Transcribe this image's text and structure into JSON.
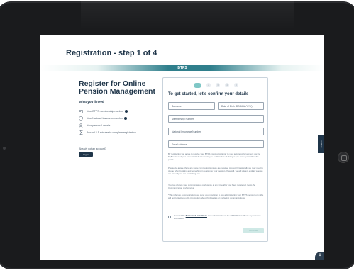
{
  "page": {
    "title": "Registration - step 1 of 4",
    "brand": "BTPS"
  },
  "intro": {
    "title_line1": "Register for Online",
    "title_line2": "Pension Management",
    "need_heading": "What you'll need",
    "items": [
      {
        "icon": "id-card-icon",
        "label": "Your BTPS membership number",
        "info": true
      },
      {
        "icon": "shield-icon",
        "label": "Your National Insurance number",
        "info": true
      },
      {
        "icon": "person-icon",
        "label": "Your personal details",
        "info": false
      },
      {
        "icon": "hourglass-icon",
        "label": "Around 2-5 minutes to complete registration",
        "info": false
      }
    ],
    "have_account": "Already got an account?",
    "login_label": "Log in"
  },
  "form": {
    "steps": [
      "1",
      "2",
      "3",
      "4",
      "5"
    ],
    "active_step": 0,
    "heading": "To get started, let's confirm your details",
    "fields": {
      "surname": "Surname",
      "dob": "Date of Birth (DD/MM/YYYY)",
      "membership": "Membership number",
      "ni": "National Insurance Number",
      "email": "Email Address"
    },
    "legal_1": "By registering you agree to receive your BTPS communications* to your secure portal account via the MyBox area of your account. We'll also email you confirmation of changes you make yourself on the portal.",
    "legal_2": "Please be aware, there are some communications we are required to post. Occasionally we may need to phone when booking and something in relation to your pension. If we call, we will always explain who we are and why we are contacting you.",
    "legal_3": "You can change your communication preference at any time after you have registered. Go to the Communication preferences.",
    "legal_4": "*This refers to communications we send you in relation to you administering your BTPS pension only. We will not contact you with information about third parties or marketing communications.",
    "agree_prefix": "I've read the",
    "agree_link": "Terms and Conditions",
    "agree_suffix": "and understand how the BTPS Portal will use my personal information.",
    "continue_label": "Continue"
  },
  "side": {
    "feedback_label": "Feedback",
    "settings_icon": "gear-icon"
  },
  "colors": {
    "navy": "#1f3549",
    "teal": "#2f7f8c",
    "mint": "#7fc7c6"
  }
}
